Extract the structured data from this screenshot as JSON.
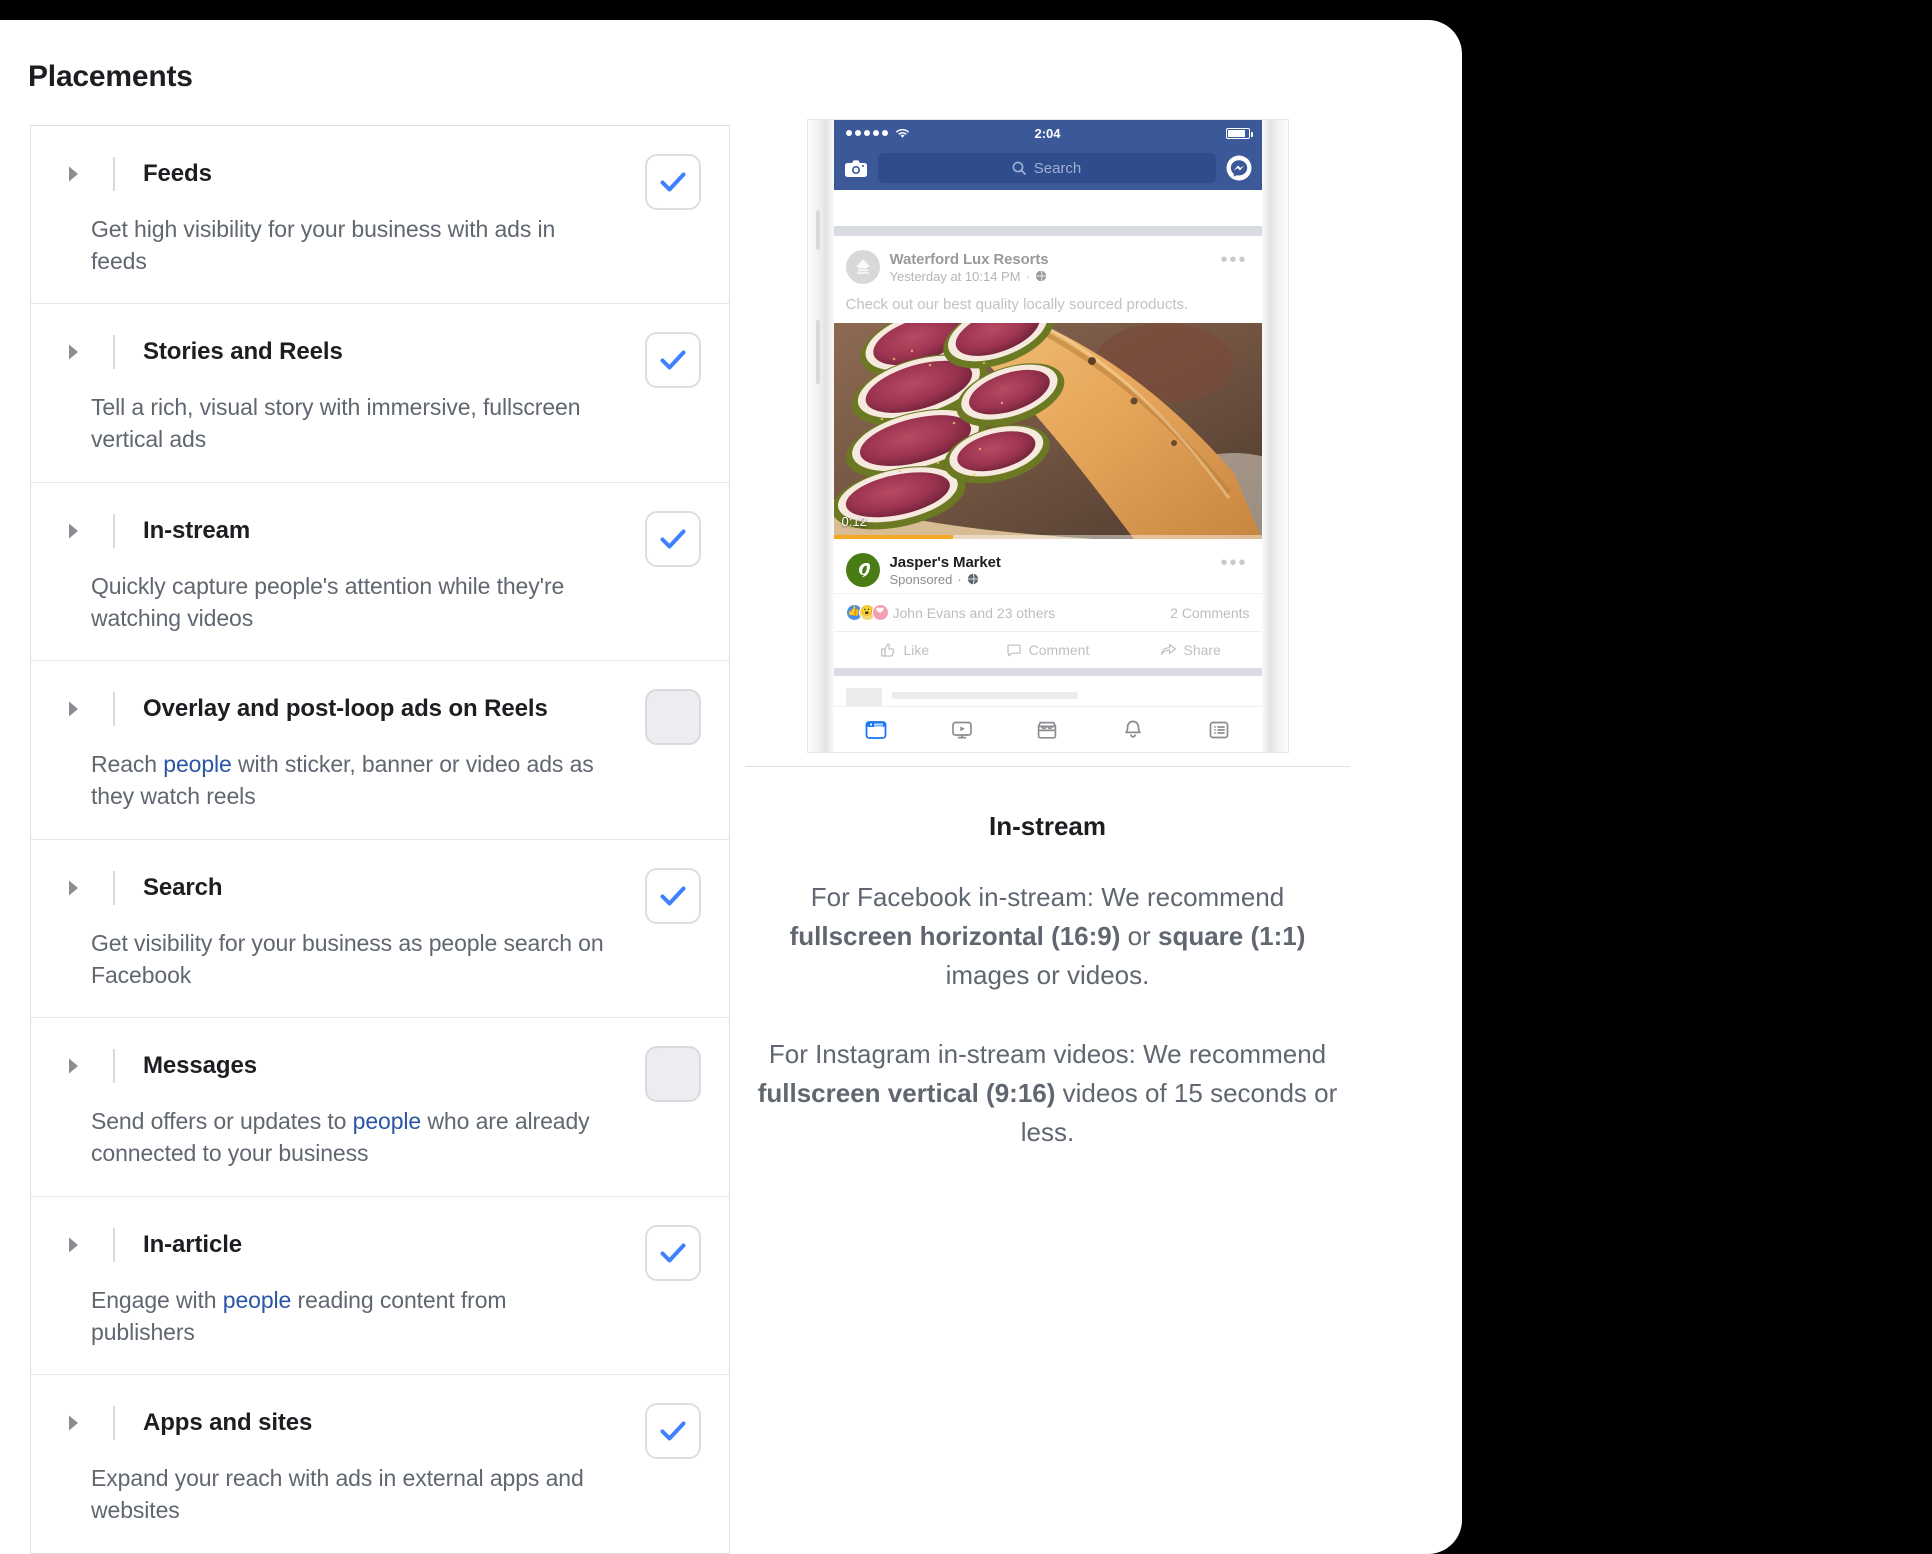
{
  "page": {
    "title": "Placements"
  },
  "placements": [
    {
      "id": "feeds",
      "label": "Feeds",
      "description_parts": [
        {
          "text": "Get high visibility for your business with ads in feeds",
          "link": false
        }
      ],
      "checked": true
    },
    {
      "id": "stories-and-reels",
      "label": "Stories and Reels",
      "description_parts": [
        {
          "text": "Tell a rich, visual story with immersive, fullscreen vertical ads",
          "link": false
        }
      ],
      "checked": true
    },
    {
      "id": "in-stream",
      "label": "In-stream",
      "description_parts": [
        {
          "text": "Quickly capture people's attention while they're watching videos",
          "link": false
        }
      ],
      "checked": true
    },
    {
      "id": "overlay-and-post-loop-ads-on-reels",
      "label": "Overlay and post-loop ads on Reels",
      "description_parts": [
        {
          "text": "Reach ",
          "link": false
        },
        {
          "text": "people",
          "link": true
        },
        {
          "text": " with sticker, banner or video ads as they watch reels",
          "link": false
        }
      ],
      "checked": false
    },
    {
      "id": "search",
      "label": "Search",
      "description_parts": [
        {
          "text": "Get visibility for your business as people search on Facebook",
          "link": false
        }
      ],
      "checked": true
    },
    {
      "id": "messages",
      "label": "Messages",
      "description_parts": [
        {
          "text": "Send offers or updates to ",
          "link": false
        },
        {
          "text": "people",
          "link": true
        },
        {
          "text": " who are already connected to your business",
          "link": false
        }
      ],
      "checked": false
    },
    {
      "id": "in-article",
      "label": "In-article",
      "description_parts": [
        {
          "text": "Engage with ",
          "link": false
        },
        {
          "text": "people",
          "link": true
        },
        {
          "text": " reading content from publishers",
          "link": false
        }
      ],
      "checked": true
    },
    {
      "id": "apps-and-sites",
      "label": "Apps and sites",
      "description_parts": [
        {
          "text": "Expand your reach with ads in external apps and websites",
          "link": false
        }
      ],
      "checked": true
    }
  ],
  "preview": {
    "phone": {
      "status_bar": {
        "time": "2:04",
        "signal_dots": 5,
        "wifi_icon": "wifi-icon",
        "battery_icon": "battery-icon"
      },
      "nav_bar": {
        "camera_icon": "camera-icon",
        "search_placeholder": "Search",
        "search_icon": "search-icon",
        "messenger_icon": "messenger-icon"
      },
      "organic_post": {
        "author": "Waterford Lux Resorts",
        "timestamp": "Yesterday at 10:14 PM",
        "privacy_icon": "globe-icon",
        "more_icon": "more-options-icon",
        "body": "Check out our best quality locally sourced products."
      },
      "media": {
        "video_time": "0:12",
        "progress_percent": 28
      },
      "sponsored_post": {
        "advertiser": "Jasper's Market",
        "sponsored_label": "Sponsored",
        "privacy_icon": "globe-icon",
        "more_icon": "more-options-icon"
      },
      "engagement": {
        "reactions_text": "John Evans and 23 others",
        "comments_text": "2 Comments"
      },
      "actions": [
        {
          "label": "Like",
          "icon": "thumbs-up-icon"
        },
        {
          "label": "Comment",
          "icon": "comment-bubble-icon"
        },
        {
          "label": "Share",
          "icon": "share-arrow-icon"
        }
      ],
      "tabbar": [
        {
          "icon": "news-feed-icon",
          "active": true
        },
        {
          "icon": "watch-video-icon",
          "active": false
        },
        {
          "icon": "marketplace-icon",
          "active": false
        },
        {
          "icon": "notifications-bell-icon",
          "active": false
        },
        {
          "icon": "menu-list-icon",
          "active": false
        }
      ]
    },
    "title": "In-stream",
    "paragraph_1": [
      {
        "text": "For Facebook in-stream: We recommend ",
        "bold": false
      },
      {
        "text": "fullscreen horizontal (16:9)",
        "bold": true
      },
      {
        "text": " or ",
        "bold": false
      },
      {
        "text": "square",
        "bold": true
      },
      {
        "text": " ",
        "bold": false
      },
      {
        "text": "(1:1)",
        "bold": true
      },
      {
        "text": " images or videos.",
        "bold": false
      }
    ],
    "paragraph_2": [
      {
        "text": "For Instagram in-stream videos: We recommend ",
        "bold": false
      },
      {
        "text": "fullscreen vertical (9:16)",
        "bold": true
      },
      {
        "text": " videos of 15 seconds or less.",
        "bold": false
      }
    ]
  },
  "colors": {
    "accent_blue": "#1877f2",
    "check_blue": "#4080ff",
    "link_blue": "#2b56a4",
    "fb_navy": "#3b5998",
    "text_primary": "#1c1e21",
    "text_secondary": "#606770",
    "border": "#dddfe2",
    "progress_orange": "#f5a623",
    "brand_green": "#4a7c16"
  }
}
